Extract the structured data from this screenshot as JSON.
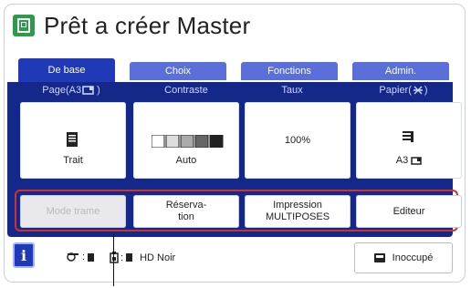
{
  "header": {
    "title": "Prêt a créer Master",
    "icon": "master-icon"
  },
  "tabs": [
    {
      "label": "De base",
      "active": true
    },
    {
      "label": "Choix",
      "active": false
    },
    {
      "label": "Fonctions",
      "active": false
    },
    {
      "label": "Admin.",
      "active": false
    }
  ],
  "settings": [
    {
      "label": "Page(A3",
      "value": "Trait",
      "icon": "document-icon"
    },
    {
      "label": "Contraste",
      "value": "Auto",
      "icon": "contrast-bar-icon"
    },
    {
      "label": "Taux",
      "value": "100%",
      "icon": ""
    },
    {
      "label": "Papier(",
      "value": "A3",
      "icon": "paper-tray-icon"
    }
  ],
  "actions": [
    {
      "label": "Mode trame",
      "disabled": true
    },
    {
      "label": "Réserva-\ntion",
      "disabled": false
    },
    {
      "label": "Impression\nMULTIPOSES",
      "disabled": false
    },
    {
      "label": "Editeur",
      "disabled": false
    }
  ],
  "status": {
    "info_label": "i",
    "drum_icon": "drum-icon",
    "ink_icon": "ink-icon",
    "ink_text": "HD Noir",
    "idle_label": "Inoccupé"
  },
  "colors": {
    "accent_blue": "#14288a",
    "active_tab": "#1f39b7",
    "inactive_tab": "#5a6fd8",
    "highlight_red": "#d2312a",
    "brand_green": "#2e9b4a"
  }
}
